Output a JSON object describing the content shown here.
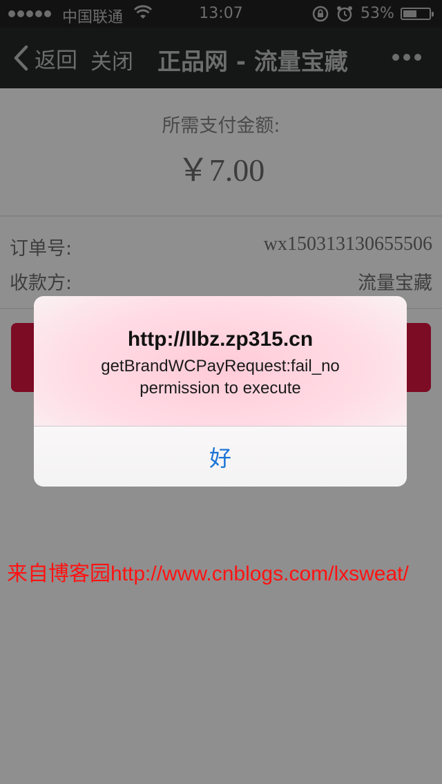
{
  "status_bar": {
    "carrier": "中国联通",
    "time": "13:07",
    "battery_percent": "53%",
    "battery_level": 0.53,
    "icons": [
      "signal-dots-icon",
      "wifi-icon",
      "rotation-lock-icon",
      "alarm-icon",
      "battery-icon"
    ]
  },
  "nav": {
    "back_label": "返回",
    "close_label": "关闭",
    "title": "正品网 - 流量宝藏",
    "more_icon": "more-dots-icon"
  },
  "payment": {
    "amount_label": "所需支付金额:",
    "amount": "￥7.00",
    "order_label": "订单号:",
    "order_number": "wx150313130655506",
    "payee_label": "收款方:",
    "payee": "流量宝藏",
    "button_color": "#7c0b24"
  },
  "alert": {
    "title": "http://llbz.zp315.cn",
    "message_line1": "getBrandWCPayRequest:fail_no",
    "message_line2": "permission to execute",
    "ok_label": "好",
    "ok_color": "#1a74d6"
  },
  "watermark": {
    "text": "来自博客园http://www.cnblogs.com/lxsweat/",
    "color": "#ff1212"
  }
}
